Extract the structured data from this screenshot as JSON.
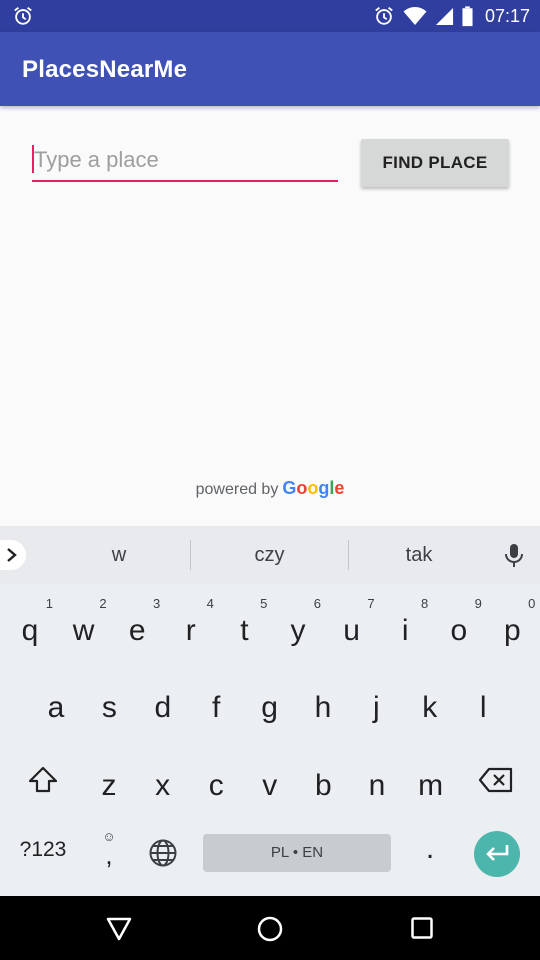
{
  "status_bar": {
    "time": "07:17",
    "color": "#303f9f",
    "icons": [
      "alarm-icon",
      "alarm-icon",
      "wifi-icon",
      "cell-signal-icon",
      "battery-icon"
    ]
  },
  "app_bar": {
    "title": "PlacesNearMe",
    "color": "#3f51b5"
  },
  "search": {
    "placeholder": "Type a place",
    "value": "",
    "accent": "#e91e63"
  },
  "find_button": {
    "label": "FIND PLACE"
  },
  "attribution": {
    "prefix": "powered by",
    "brand_letters": [
      {
        "ch": "G",
        "color": "#4285f4"
      },
      {
        "ch": "o",
        "color": "#ea4335"
      },
      {
        "ch": "o",
        "color": "#fbbc05"
      },
      {
        "ch": "g",
        "color": "#4285f4"
      },
      {
        "ch": "l",
        "color": "#34a853"
      },
      {
        "ch": "e",
        "color": "#ea4335"
      }
    ]
  },
  "keyboard": {
    "suggestions": [
      "w",
      "czy",
      "tak"
    ],
    "row1": [
      {
        "ch": "q",
        "sup": "1"
      },
      {
        "ch": "w",
        "sup": "2"
      },
      {
        "ch": "e",
        "sup": "3"
      },
      {
        "ch": "r",
        "sup": "4"
      },
      {
        "ch": "t",
        "sup": "5"
      },
      {
        "ch": "y",
        "sup": "6"
      },
      {
        "ch": "u",
        "sup": "7"
      },
      {
        "ch": "i",
        "sup": "8"
      },
      {
        "ch": "o",
        "sup": "9"
      },
      {
        "ch": "p",
        "sup": "0"
      }
    ],
    "row2": [
      "a",
      "s",
      "d",
      "f",
      "g",
      "h",
      "j",
      "k",
      "l"
    ],
    "row3": [
      "z",
      "x",
      "c",
      "v",
      "b",
      "n",
      "m"
    ],
    "symbols_label": "?123",
    "comma_label": ",",
    "emoji_hint": "☺",
    "space_label": "PL • EN",
    "period_label": ".",
    "enter_color": "#4db6ac"
  },
  "nav_bar": {
    "icons": [
      "back-icon",
      "home-icon",
      "recents-icon"
    ]
  }
}
